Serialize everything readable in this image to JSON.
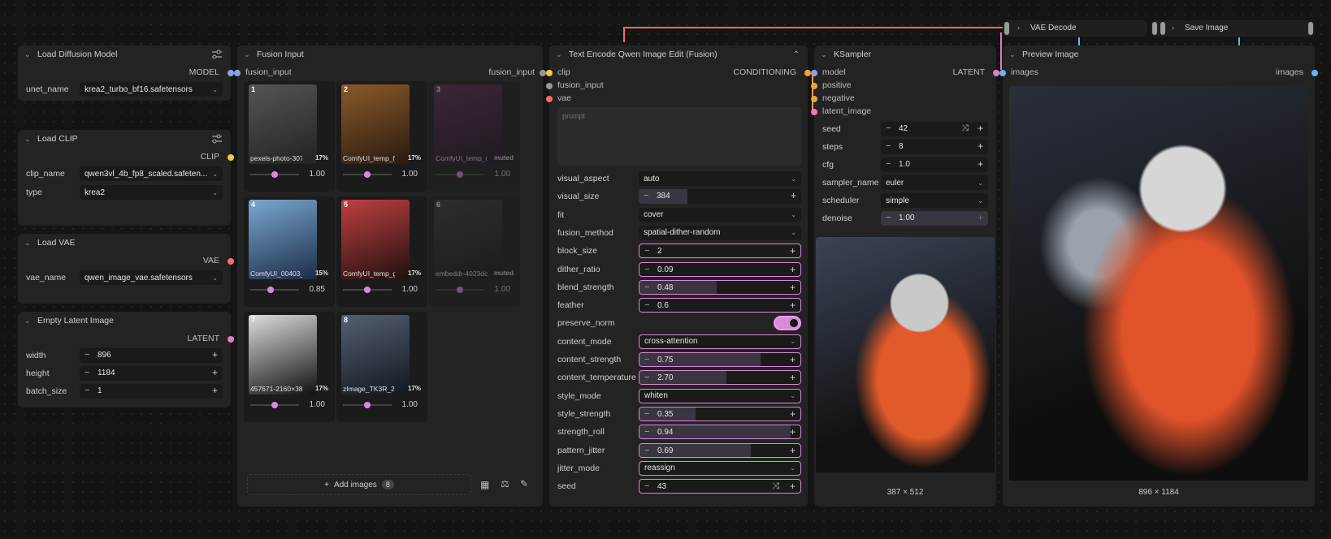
{
  "colors": {
    "model": "#8fa2e8",
    "clip": "#f2c94c",
    "vae": "#ff6b6b",
    "latent": "#e879c9",
    "image": "#64b5f6",
    "conditioning": "#f0a040",
    "accent": "#d98ad8"
  },
  "load_model": {
    "title": "Load Diffusion Model",
    "out": "MODEL",
    "unet_label": "unet_name",
    "unet_value": "krea2_turbo_bf16.safetensors"
  },
  "load_clip": {
    "title": "Load CLIP",
    "out": "CLIP",
    "clip_label": "clip_name",
    "clip_value": "qwen3vl_4b_fp8_scaled.safeten...",
    "type_label": "type",
    "type_value": "krea2"
  },
  "load_vae": {
    "title": "Load VAE",
    "out": "VAE",
    "label": "vae_name",
    "value": "qwen_image_vae.safetensors"
  },
  "empty_latent": {
    "title": "Empty Latent Image",
    "out": "LATENT",
    "width_label": "width",
    "width": "896",
    "height_label": "height",
    "height": "1184",
    "batch_label": "batch_size",
    "batch": "1"
  },
  "fusion": {
    "title": "Fusion Input",
    "in_label": "fusion_input",
    "out_label": "fusion_input",
    "add_label": "Add images",
    "count": "8",
    "items": [
      {
        "n": "1",
        "name": "pexels-photo-3078...",
        "pct": "17%",
        "val": "1.00",
        "level": 0.5
      },
      {
        "n": "2",
        "name": "ComfyUI_temp_fjhb...",
        "pct": "17%",
        "val": "1.00",
        "level": 0.5
      },
      {
        "n": "3",
        "name": "ComfyUI_temp_o...",
        "pct": "muted",
        "val": "1.00",
        "level": 0.5
      },
      {
        "n": "4",
        "name": "ComfyUI_00403_w...",
        "pct": "15%",
        "val": "0.85",
        "level": 0.42
      },
      {
        "n": "5",
        "name": "ComfyUI_temp_gsy...",
        "pct": "17%",
        "val": "1.00",
        "level": 0.5
      },
      {
        "n": "6",
        "name": "embeddr-4023dc...",
        "pct": "muted",
        "val": "1.00",
        "level": 0.5
      },
      {
        "n": "7",
        "name": "457671-2160×3840...",
        "pct": "17%",
        "val": "1.00",
        "level": 0.5
      },
      {
        "n": "8",
        "name": "zImage_TK3R_2025...",
        "pct": "17%",
        "val": "1.00",
        "level": 0.5
      }
    ]
  },
  "encode": {
    "title": "Text Encode Qwen Image Edit (Fusion)",
    "in_clip": "clip",
    "in_fusion": "fusion_input",
    "in_vae": "vae",
    "out": "CONDITIONING",
    "prompt_placeholder": "prompt",
    "rows": [
      {
        "label": "visual_aspect",
        "kind": "combo",
        "value": "auto"
      },
      {
        "label": "visual_size",
        "kind": "num",
        "value": "384",
        "fill": 0.3
      },
      {
        "label": "fit",
        "kind": "combo",
        "value": "cover"
      },
      {
        "label": "fusion_method",
        "kind": "combo",
        "value": "spatial-dither-random"
      },
      {
        "label": "block_size",
        "kind": "num",
        "value": "2",
        "fill": 0.0,
        "sel": true
      },
      {
        "label": "dither_ratio",
        "kind": "num",
        "value": "0.09",
        "fill": 0.0,
        "sel": true
      },
      {
        "label": "blend_strength",
        "kind": "num",
        "value": "0.48",
        "fill": 0.48,
        "sel": true
      },
      {
        "label": "feather",
        "kind": "num",
        "value": "0.6",
        "fill": 0.0,
        "sel": true
      },
      {
        "label": "preserve_norm",
        "kind": "toggle",
        "value": true
      },
      {
        "label": "content_mode",
        "kind": "combo",
        "value": "cross-attention",
        "sel": true
      },
      {
        "label": "content_strength",
        "kind": "num",
        "value": "0.75",
        "fill": 0.75,
        "sel": true
      },
      {
        "label": "content_temperature",
        "kind": "num",
        "value": "2.70",
        "fill": 0.54,
        "sel": true
      },
      {
        "label": "style_mode",
        "kind": "combo",
        "value": "whiten",
        "sel": true
      },
      {
        "label": "style_strength",
        "kind": "num",
        "value": "0.35",
        "fill": 0.35,
        "sel": true
      },
      {
        "label": "strength_roll",
        "kind": "num",
        "value": "0.94",
        "fill": 0.94,
        "sel": true
      },
      {
        "label": "pattern_jitter",
        "kind": "num",
        "value": "0.69",
        "fill": 0.69,
        "sel": true
      },
      {
        "label": "jitter_mode",
        "kind": "combo",
        "value": "reassign",
        "sel": true
      },
      {
        "label": "seed",
        "kind": "seed",
        "value": "43",
        "sel": true
      }
    ]
  },
  "ksampler": {
    "title": "KSampler",
    "in_model": "model",
    "in_positive": "positive",
    "in_negative": "negative",
    "in_latent": "latent_image",
    "out": "LATENT",
    "seed_label": "seed",
    "seed": "42",
    "steps_label": "steps",
    "steps": "8",
    "cfg_label": "cfg",
    "cfg": "1.0",
    "sampler_label": "sampler_name",
    "sampler": "euler",
    "scheduler_label": "scheduler",
    "scheduler": "simple",
    "denoise_label": "denoise",
    "denoise": "1.00",
    "preview_size": "387 × 512"
  },
  "vae_decode": {
    "title": "VAE Decode"
  },
  "save_image": {
    "title": "Save Image"
  },
  "preview": {
    "title": "Preview Image",
    "in_label": "images",
    "out_label": "images",
    "size": "896 × 1184"
  }
}
